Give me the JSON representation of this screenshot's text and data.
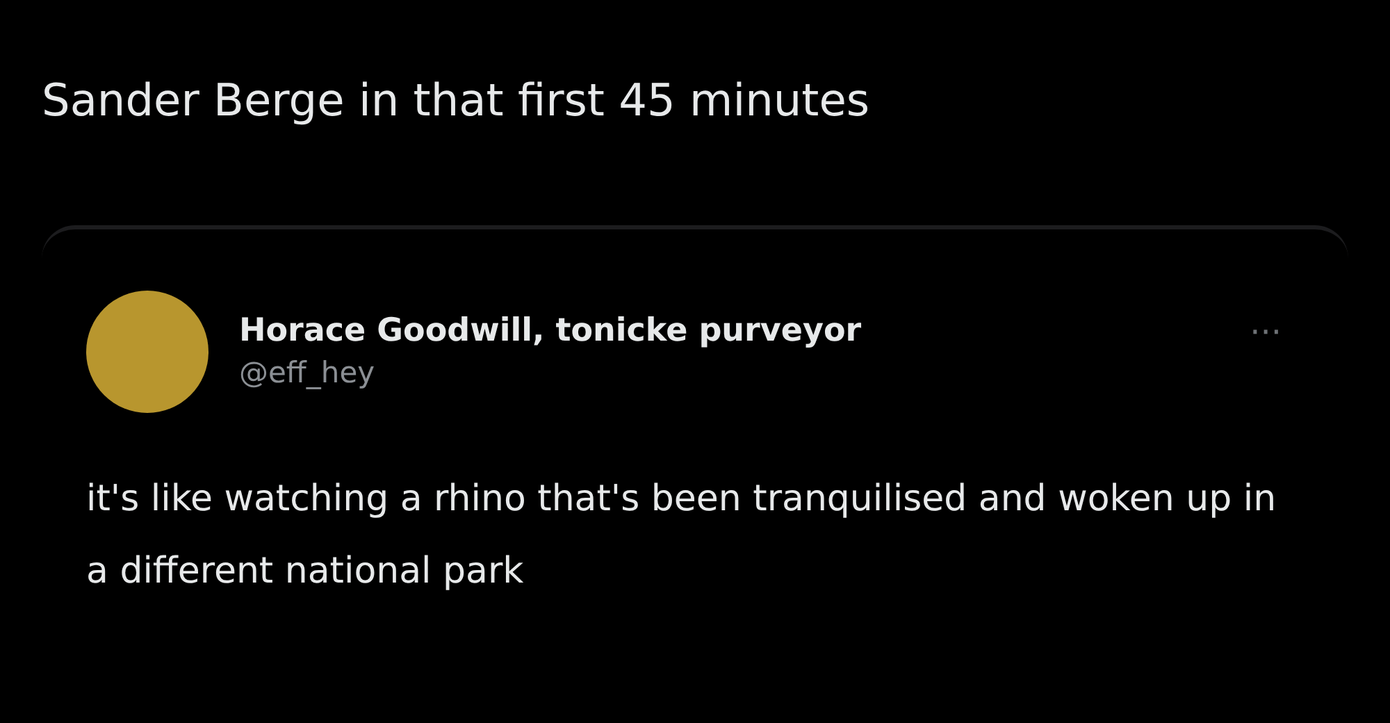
{
  "post": {
    "text": "Sander Berge in that first 45 minutes"
  },
  "quoted_post": {
    "author_name": "Horace Goodwill, tonicke purveyor",
    "handle": "@eff_hey",
    "more": "···",
    "text": "it's like watching a rhino that's been tranquilised and woken up in a different national park"
  }
}
